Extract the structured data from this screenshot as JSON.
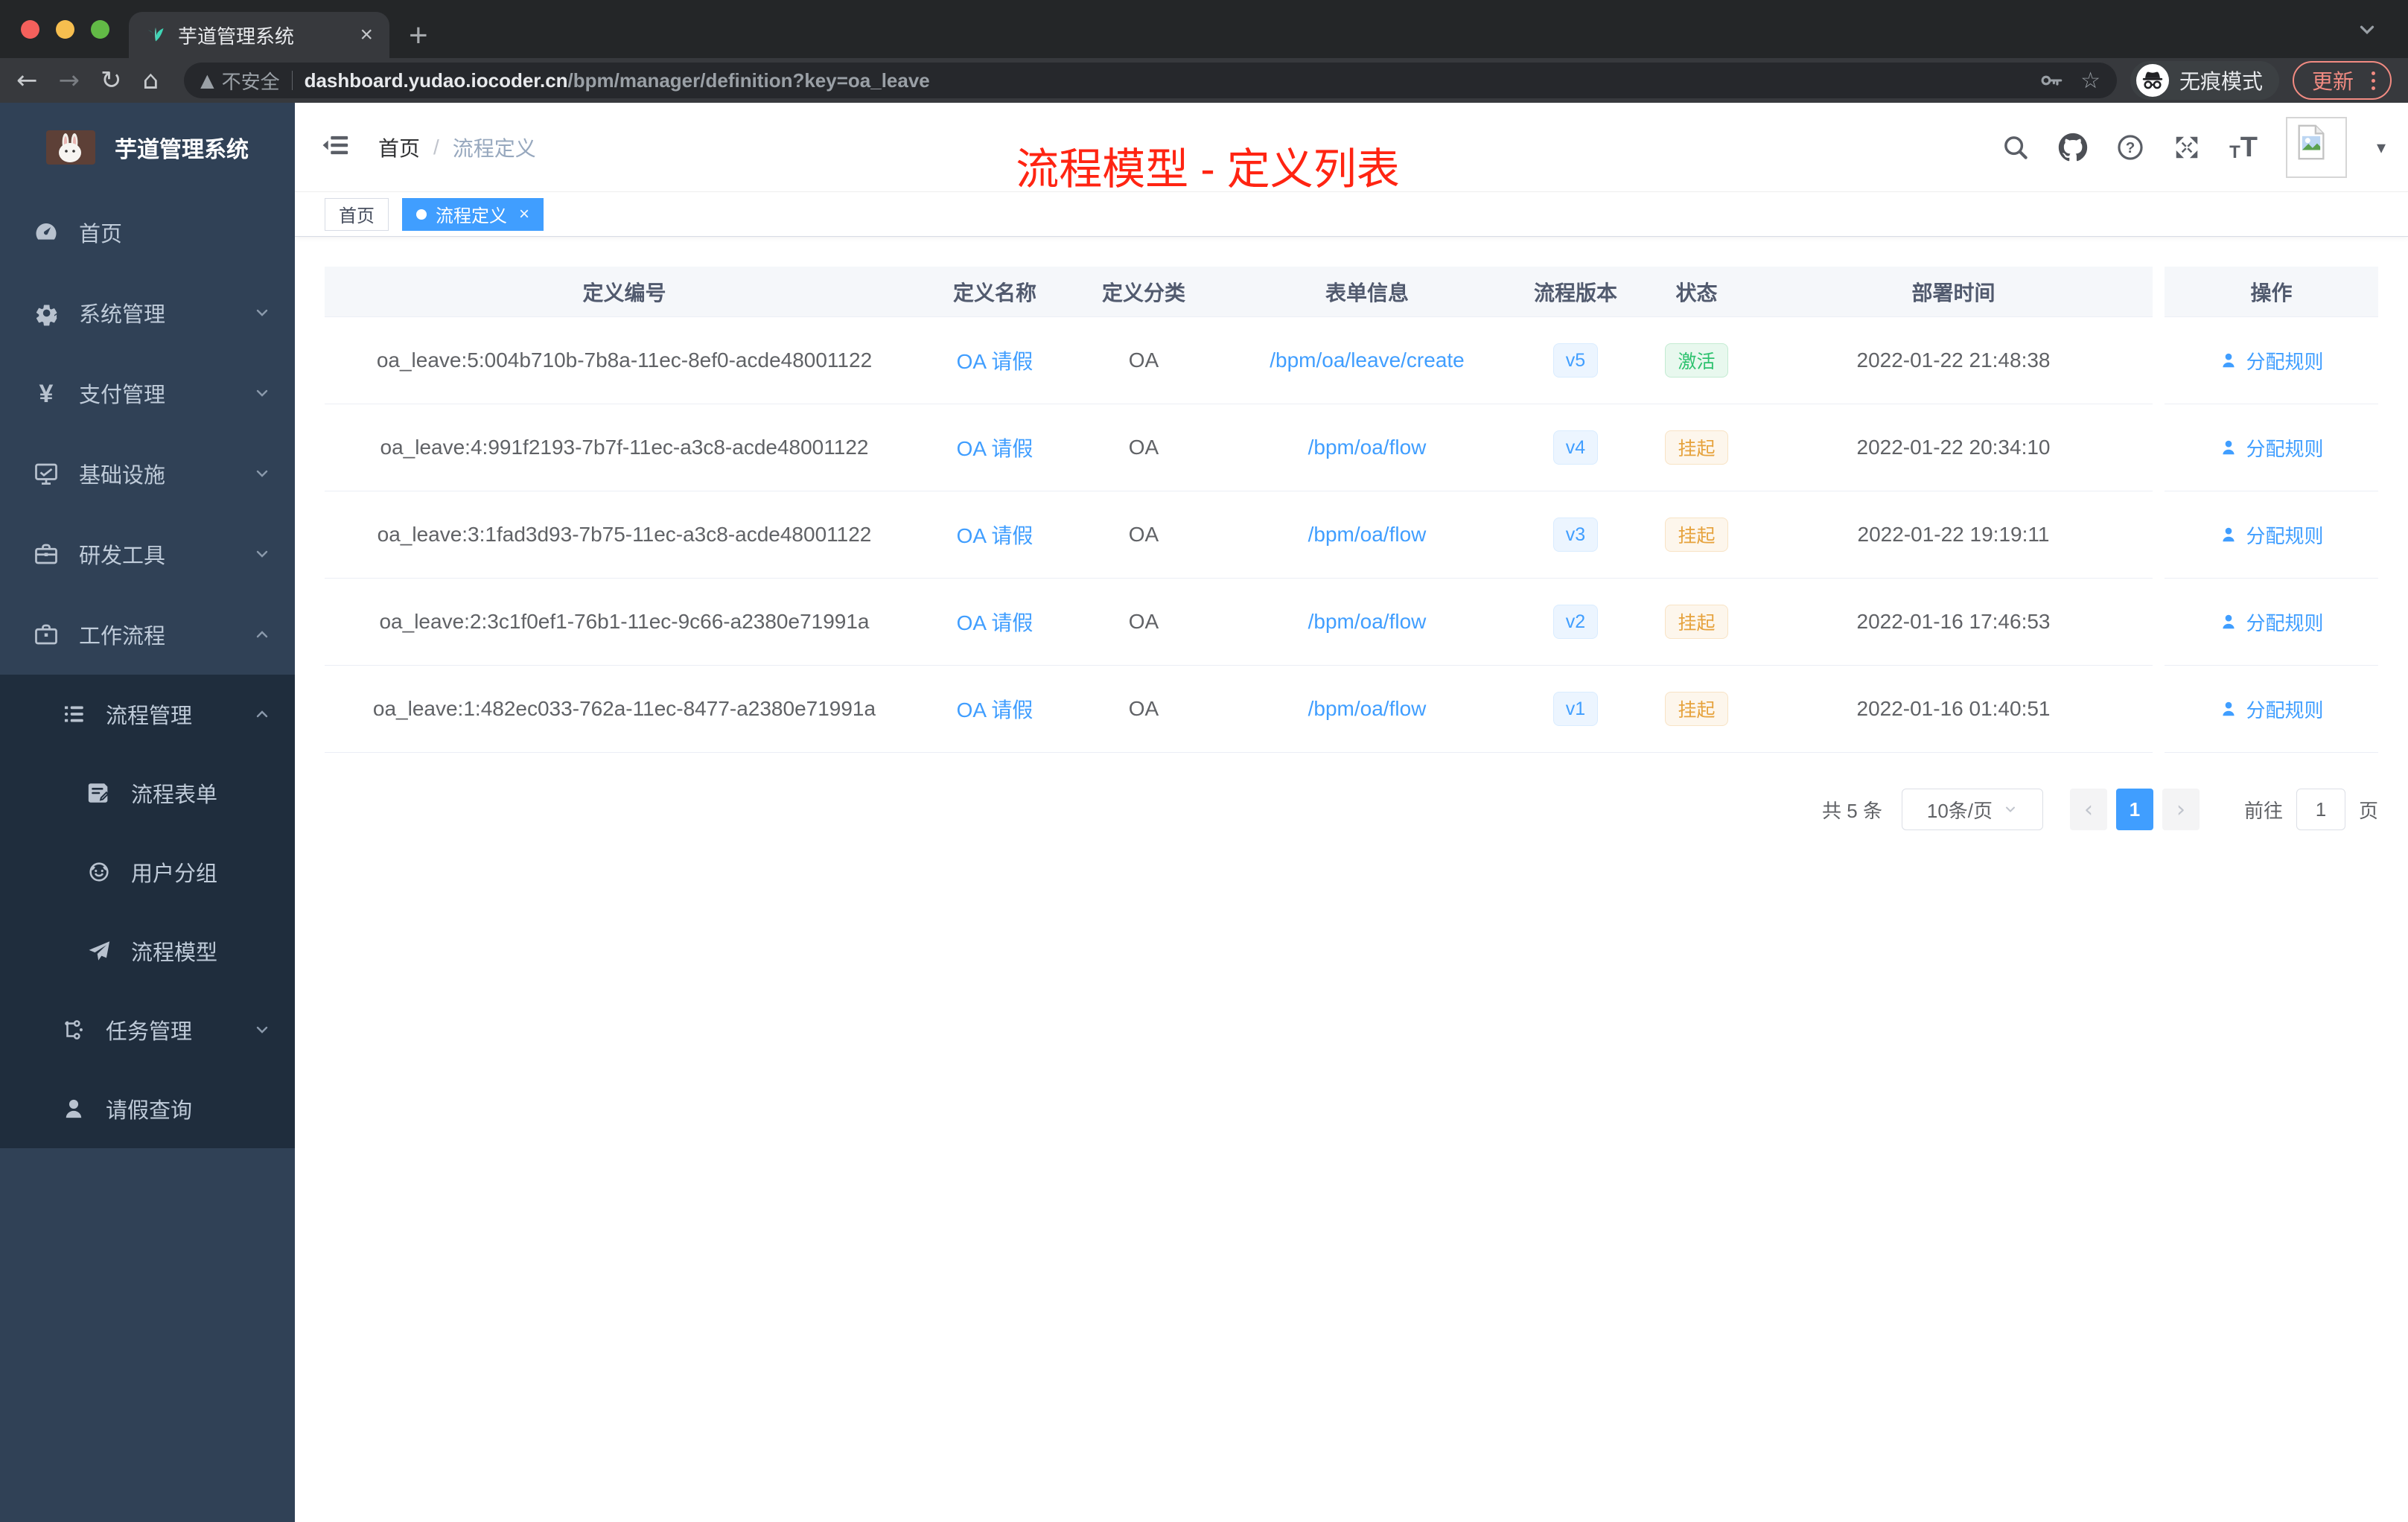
{
  "browser": {
    "tab_title": "芋道管理系统",
    "new_tab_label": "+",
    "security_label": "不安全",
    "url_domain": "dashboard.yudao.iocoder.cn",
    "url_path": "/bpm/manager/definition?key=oa_leave",
    "incognito_label": "无痕模式",
    "update_label": "更新"
  },
  "sidebar": {
    "logo_title": "芋道管理系统",
    "items": [
      {
        "label": "首页",
        "icon": "dashboard-icon"
      },
      {
        "label": "系统管理",
        "icon": "gear-icon",
        "chevron": "down"
      },
      {
        "label": "支付管理",
        "icon": "yen-icon",
        "chevron": "down"
      },
      {
        "label": "基础设施",
        "icon": "monitor-icon",
        "chevron": "down"
      },
      {
        "label": "研发工具",
        "icon": "toolbox-icon",
        "chevron": "down"
      },
      {
        "label": "工作流程",
        "icon": "briefcase-icon",
        "chevron": "up",
        "expanded": true
      }
    ],
    "submenu": [
      {
        "label": "流程管理",
        "icon": "list-icon",
        "chevron": "up",
        "level": 1
      },
      {
        "label": "流程表单",
        "icon": "form-icon",
        "level": 2
      },
      {
        "label": "用户分组",
        "icon": "people-icon",
        "level": 2
      },
      {
        "label": "流程模型",
        "icon": "send-icon",
        "level": 2
      },
      {
        "label": "任务管理",
        "icon": "tree-icon",
        "chevron": "down",
        "level": 1
      },
      {
        "label": "请假查询",
        "icon": "user-icon",
        "level": 1
      }
    ]
  },
  "header": {
    "breadcrumb_home": "首页",
    "breadcrumb_sep": "/",
    "breadcrumb_current": "流程定义",
    "annotation": "流程模型 - 定义列表",
    "annotation_color": "#ff2412"
  },
  "tags": {
    "home": "首页",
    "active": "流程定义",
    "close": "×"
  },
  "table": {
    "headers": [
      "定义编号",
      "定义名称",
      "定义分类",
      "表单信息",
      "流程版本",
      "状态",
      "部署时间",
      "操作"
    ],
    "rows": [
      {
        "id": "oa_leave:5:004b710b-7b8a-11ec-8ef0-acde48001122",
        "name": "OA 请假",
        "category": "OA",
        "form": "/bpm/oa/leave/create",
        "version": "v5",
        "status": "激活",
        "status_type": "success",
        "deploy_time": "2022-01-22 21:48:38",
        "action": "分配规则"
      },
      {
        "id": "oa_leave:4:991f2193-7b7f-11ec-a3c8-acde48001122",
        "name": "OA 请假",
        "category": "OA",
        "form": "/bpm/oa/flow",
        "version": "v4",
        "status": "挂起",
        "status_type": "warning",
        "deploy_time": "2022-01-22 20:34:10",
        "action": "分配规则"
      },
      {
        "id": "oa_leave:3:1fad3d93-7b75-11ec-a3c8-acde48001122",
        "name": "OA 请假",
        "category": "OA",
        "form": "/bpm/oa/flow",
        "version": "v3",
        "status": "挂起",
        "status_type": "warning",
        "deploy_time": "2022-01-22 19:19:11",
        "action": "分配规则"
      },
      {
        "id": "oa_leave:2:3c1f0ef1-76b1-11ec-9c66-a2380e71991a",
        "name": "OA 请假",
        "category": "OA",
        "form": "/bpm/oa/flow",
        "version": "v2",
        "status": "挂起",
        "status_type": "warning",
        "deploy_time": "2022-01-16 17:46:53",
        "action": "分配规则"
      },
      {
        "id": "oa_leave:1:482ec033-762a-11ec-8477-a2380e71991a",
        "name": "OA 请假",
        "category": "OA",
        "form": "/bpm/oa/flow",
        "version": "v1",
        "status": "挂起",
        "status_type": "warning",
        "deploy_time": "2022-01-16 01:40:51",
        "action": "分配规则"
      }
    ]
  },
  "pagination": {
    "total": "共 5 条",
    "page_size": "10条/页",
    "current_page": "1",
    "goto_label": "前往",
    "goto_value": "1",
    "page_unit": "页"
  },
  "colors": {
    "accent": "#409eff",
    "link": "#409eff",
    "active_tag_bg": "#409eff",
    "success_text": "#2dc26e",
    "warning_text": "#e6a23c",
    "sidebar_bg": "#304156",
    "submenu_bg": "#1f2d3d",
    "annotation_red": "#ff2412",
    "update_badge": "#f28b82"
  }
}
